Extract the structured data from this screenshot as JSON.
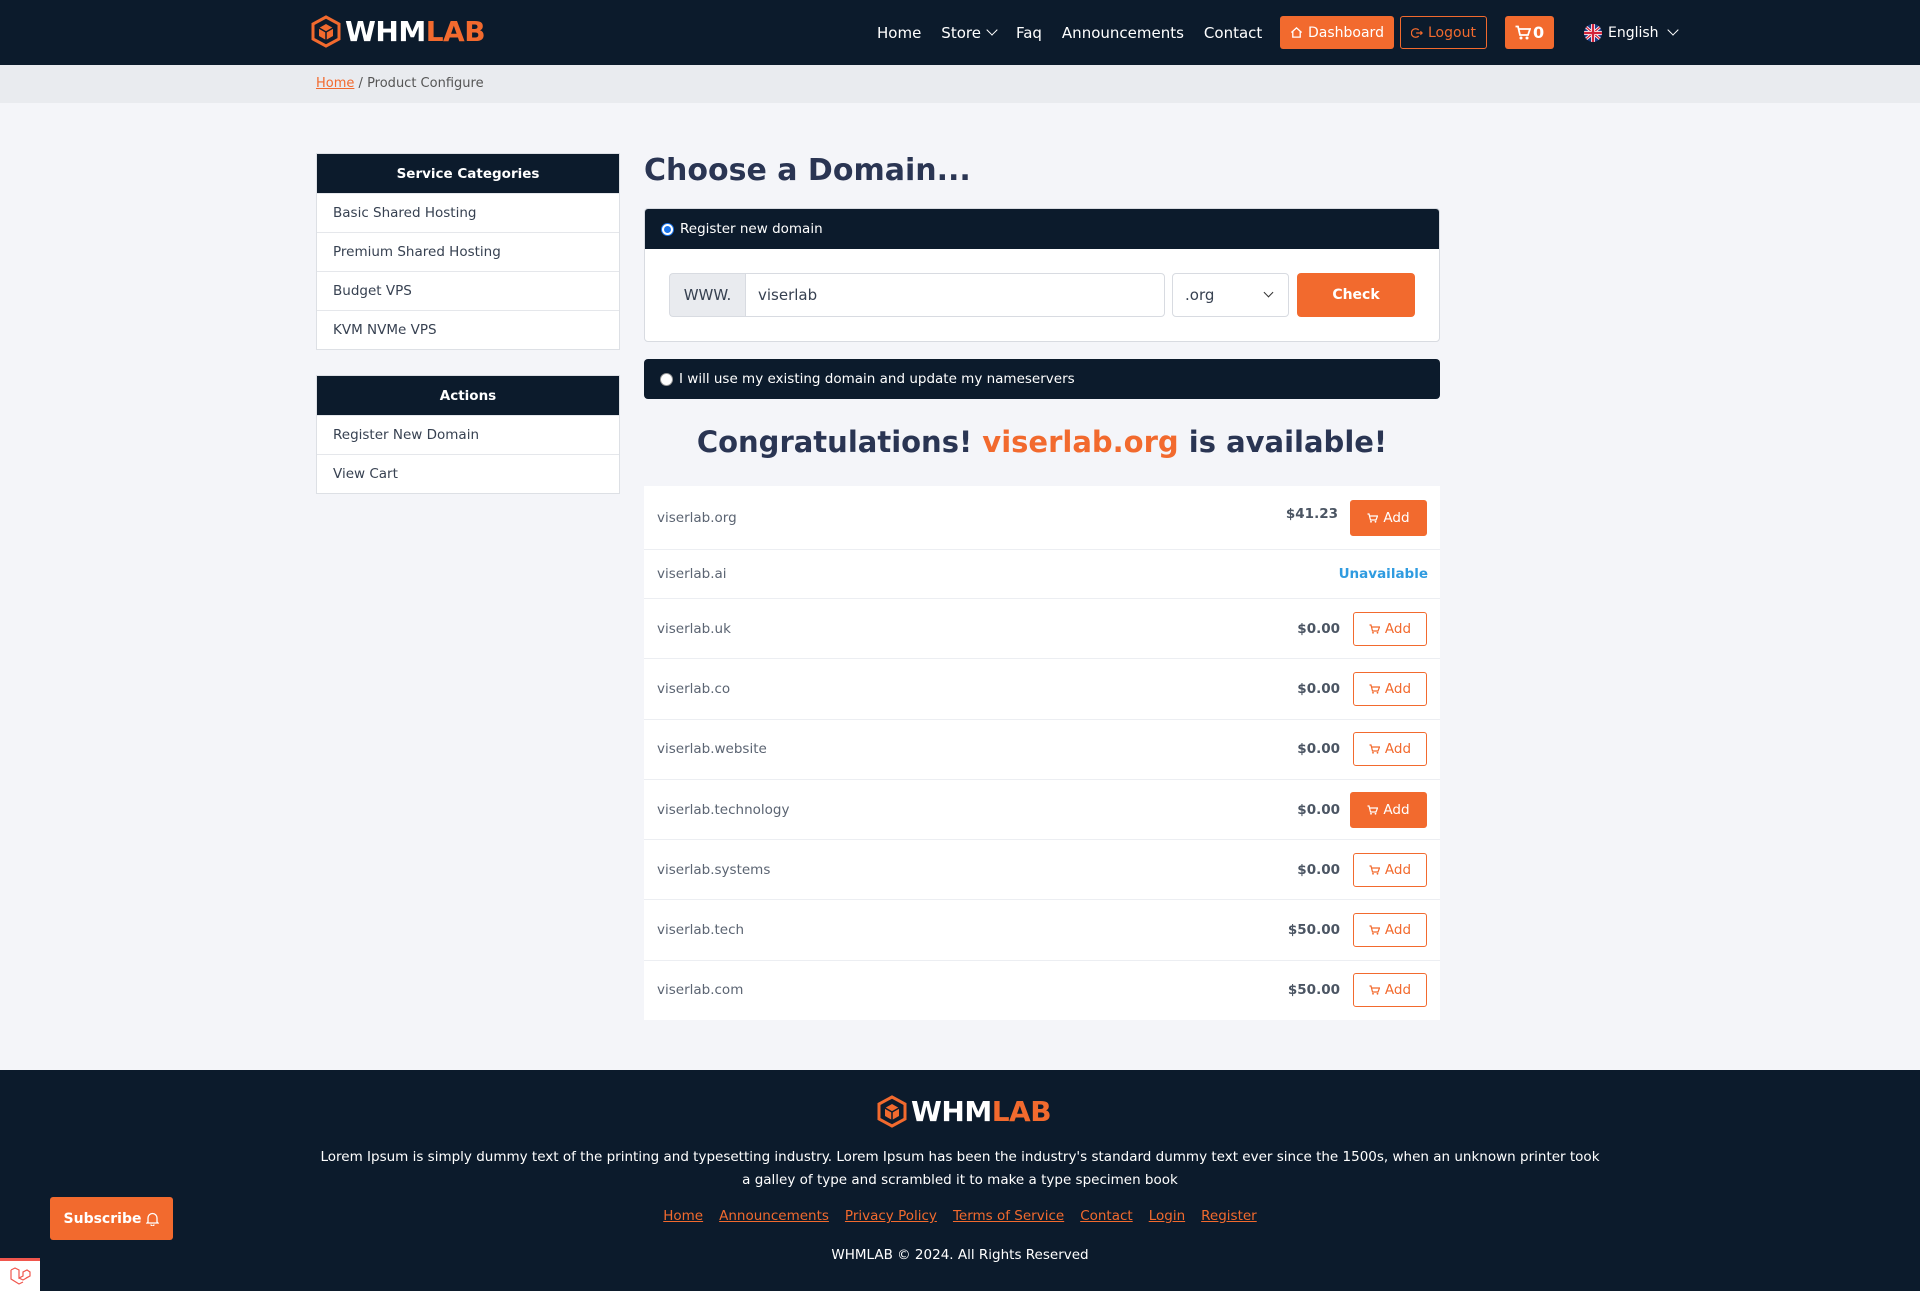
{
  "brand": {
    "name_white": "WHM",
    "name_accent": "LAB"
  },
  "nav": {
    "home": "Home",
    "store": "Store",
    "faq": "Faq",
    "announcements": "Announcements",
    "contact": "Contact",
    "dashboard": "Dashboard",
    "logout": "Logout",
    "cart_count": "0",
    "language": "English"
  },
  "breadcrumb": {
    "home": "Home",
    "separator": "/",
    "current": "Product Configure"
  },
  "sidebar": {
    "categories": {
      "title": "Service Categories",
      "items": [
        "Basic Shared Hosting",
        "Premium Shared Hosting",
        "Budget VPS",
        "KVM NVMe VPS"
      ]
    },
    "actions": {
      "title": "Actions",
      "items": [
        "Register New Domain",
        "View Cart"
      ]
    }
  },
  "main": {
    "title": "Choose a Domain...",
    "register_option": "Register new domain",
    "www_prefix": "WWW.",
    "domain_value": "viserlab",
    "tld_selected": ".org",
    "check_label": "Check",
    "existing_option": "I will use my existing domain and update my nameservers",
    "congrats_prefix": "Congratulations!",
    "congrats_domain": "viserlab.org",
    "congrats_suffix": "is available!",
    "add_label": "Add",
    "unavailable_label": "Unavailable",
    "results": [
      {
        "domain": "viserlab.org",
        "price": "$41.23",
        "status": "available",
        "style": "filled"
      },
      {
        "domain": "viserlab.ai",
        "price": "",
        "status": "unavailable",
        "style": ""
      },
      {
        "domain": "viserlab.uk",
        "price": "$0.00",
        "status": "available",
        "style": "outline"
      },
      {
        "domain": "viserlab.co",
        "price": "$0.00",
        "status": "available",
        "style": "outline"
      },
      {
        "domain": "viserlab.website",
        "price": "$0.00",
        "status": "available",
        "style": "outline"
      },
      {
        "domain": "viserlab.technology",
        "price": "$0.00",
        "status": "available",
        "style": "filled"
      },
      {
        "domain": "viserlab.systems",
        "price": "$0.00",
        "status": "available",
        "style": "outline"
      },
      {
        "domain": "viserlab.tech",
        "price": "$50.00",
        "status": "available",
        "style": "outline"
      },
      {
        "domain": "viserlab.com",
        "price": "$50.00",
        "status": "available",
        "style": "outline"
      }
    ]
  },
  "footer": {
    "description": "Lorem Ipsum is simply dummy text of the printing and typesetting industry. Lorem Ipsum has been the industry's standard dummy text ever since the 1500s, when an unknown printer took a galley of type and scrambled it to make a type specimen book",
    "links": [
      "Home",
      "Announcements",
      "Privacy Policy",
      "Terms of Service",
      "Contact",
      "Login",
      "Register"
    ],
    "copyright": "WHMLAB © 2024. All Rights Reserved"
  },
  "subscribe": {
    "label": "Subscribe"
  },
  "colors": {
    "primary": "#f26a2e",
    "dark": "#0c1b2c",
    "heading": "#2a3553",
    "link_blue": "#2f9be0"
  },
  "icons": [
    "whmlab-cube-logo",
    "chevron-down-icon",
    "home-icon",
    "logout-icon",
    "cart-icon",
    "uk-flag-icon",
    "bell-icon",
    "laravel-icon"
  ]
}
